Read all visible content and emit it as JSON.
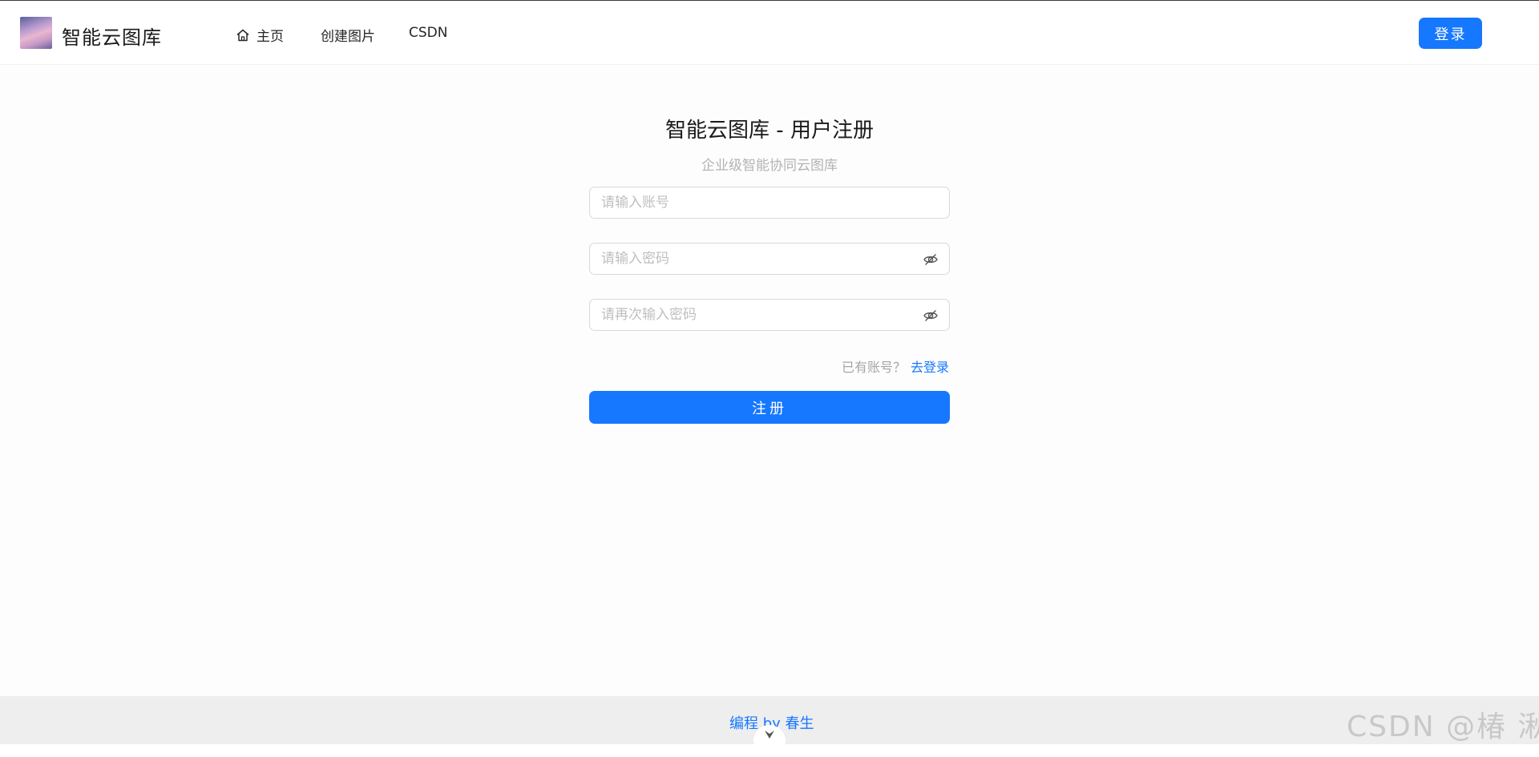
{
  "header": {
    "logo_title": "智能云图库",
    "nav": {
      "home_label": "主页",
      "create_label": "创建图片",
      "csdn_label": "CSDN"
    },
    "login_button": "登录"
  },
  "form": {
    "title": "智能云图库 - 用户注册",
    "subtitle": "企业级智能协同云图库",
    "account": {
      "placeholder": "请输入账号",
      "value": ""
    },
    "password": {
      "placeholder": "请输入密码",
      "value": ""
    },
    "confirm_password": {
      "placeholder": "请再次输入密码",
      "value": ""
    },
    "have_account_text": "已有账号？",
    "go_login_link": "去登录",
    "register_button": "注册"
  },
  "footer": {
    "link_text": "编程 by 春生",
    "watermark": "CSDN @椿  湫"
  },
  "colors": {
    "accent": "#1677ff",
    "placeholder": "#bfbfbf",
    "footer_bg": "#eeeeee"
  },
  "icons": {
    "home": "home-icon",
    "password_toggle": "eye-invisible-icon",
    "scroll_down": "chevron-down-icon"
  }
}
